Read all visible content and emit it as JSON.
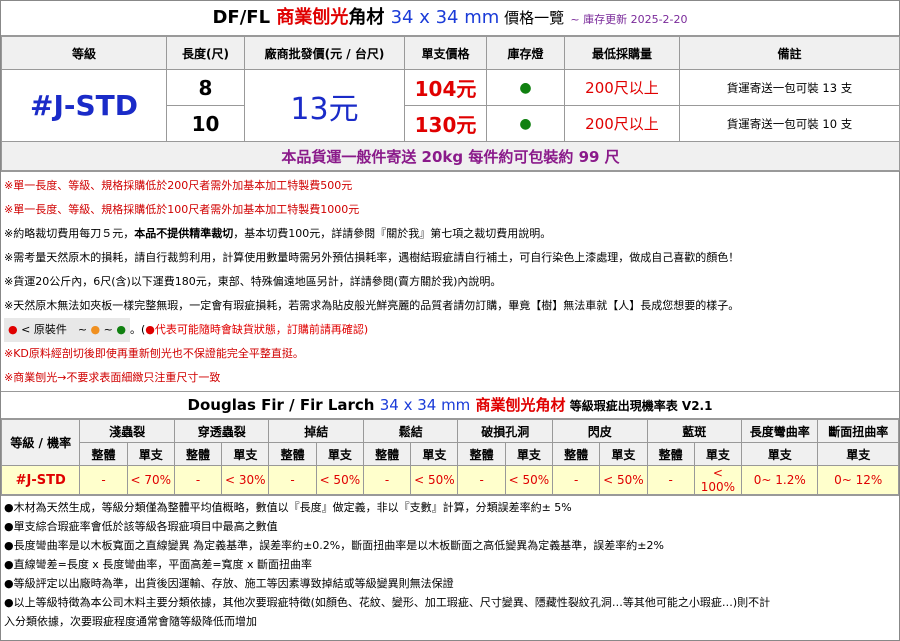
{
  "title": {
    "part1": "DF/FL ",
    "part2": "商業刨光",
    "part3": "角材 ",
    "part4": "34 x 34 mm",
    "part5": " 價格一覽",
    "update": "~ 庫存更新 2025-2-20"
  },
  "price_table": {
    "headers": [
      "等級",
      "長度(尺)",
      "廠商批發價(元 / 台尺)",
      "單支價格",
      "庫存燈",
      "最低採購量",
      "備註"
    ],
    "grade": "#J-STD",
    "wholesale": "13元",
    "rows": [
      {
        "length": "8",
        "price": "104元",
        "stock": "●",
        "min": "200尺以上",
        "note": "貨運寄送一包可裝 13 支"
      },
      {
        "length": "10",
        "price": "130元",
        "stock": "●",
        "min": "200尺以上",
        "note": "貨運寄送一包可裝 10 支"
      }
    ],
    "shipping": "本品貨運一般件寄送 20kg 每件約可包裝約 99 尺"
  },
  "notes": {
    "n1": "※單一長度、等級、規格採購低於200尺者需外加基本加工特製費500元",
    "n2": "※單一長度、等級、規格採購低於100尺者需外加基本加工特製費1000元",
    "n3a": "※約略裁切費用每刀５元，",
    "n3b": "本品不提供精準裁切",
    "n3c": "，基本切費100元，詳請參閱『關於我』第七項之裁切費用說明。",
    "n4": "※需考量天然原木的損耗，請自行裁剪利用，計算使用數量時需另外預估損耗率，遇樹結瑕疵請自行補土，可自行染色上漆處理，做成自己喜歡的顏色！",
    "n5": "※貨運20公斤內，6尺(含)以下運費180元，東部、特殊偏遠地區另計，詳請參閱(賣方關於我)內說明。",
    "n6": "※天然原木無法如夾板一樣完整無瑕，一定會有瑕疵損耗，若需求為貼皮般光鮮亮麗的品質者請勿訂購，畢竟【樹】無法車就【人】長成您想要的樣子。",
    "legend_dot1": "●",
    "legend_text": " < 原裝件　~",
    "legend_dot2": "●",
    "legend_tilde": " ~ ",
    "legend_dot3": "●",
    "legend_dot4": "●",
    "legend_after1": "。(",
    "legend_dot5": "●",
    "legend_after2": "代表可能隨時會缺貨狀態，訂購前請再確認)",
    "n7": "※KD原料經剖切後即使再重新刨光也不保證能完全平整直挺。",
    "n8": "※商業刨光→不要求表面細緻只注重尺寸一致"
  },
  "defect_table": {
    "title1": "Douglas Fir / Fir Larch ",
    "title2": "34 x 34 mm",
    "title3": " 商業刨光角材",
    "title4": " 等級瑕疵出現機率表 V2.1",
    "head_grade": "等級 / 機率",
    "groups": [
      "淺蟲裂",
      "穿透蟲裂",
      "掉結",
      "鬆結",
      "破損孔洞",
      "閃皮",
      "藍斑",
      "長度彎曲率",
      "斷面扭曲率"
    ],
    "sub_whole": "整體",
    "sub_single": "單支",
    "grade": "#J-STD",
    "values": [
      "-",
      "< 70%",
      "-",
      "< 30%",
      "-",
      "< 50%",
      "-",
      "< 50%",
      "-",
      "< 50%",
      "-",
      "< 50%",
      "-",
      "< 100%",
      "0~ 1.2%",
      "0~ 12%"
    ]
  },
  "notes2": [
    "●木材為天然生成，等級分類僅為整體平均值概略，數值以『長度』做定義，非以『支數』計算，分類誤差率約± 5%",
    "●單支綜合瑕疵率會低於該等級各瑕疵項目中最高之數值",
    "●長度彎曲率是以木板寬面之直線變異 為定義基準，誤差率約±0.2%，斷面扭曲率是以木板斷面之高低變異為定義基準，誤差率約±2%",
    "●直線彎差=長度 x 長度彎曲率，平面高差=寬度 x 斷面扭曲率",
    "●等級評定以出廠時為準，出貨後因運輸、存放、施工等因素導致掉結或等級變異則無法保證",
    "●以上等級特徵為本公司木料主要分類依據，其他次要瑕疵特徵(如顏色、花紋、變形、加工瑕疵、尺寸變異、隱藏性裂紋孔洞…等其他可能之小瑕疵…)則不計",
    "入分類依據，次要瑕疵程度通常會隨等級降低而增加"
  ]
}
